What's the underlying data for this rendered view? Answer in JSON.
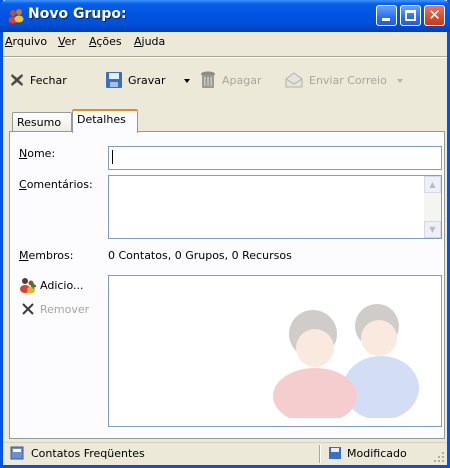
{
  "window": {
    "title": "Novo Grupo:"
  },
  "menu": [
    "Arquivo",
    "Ver",
    "Ações",
    "Ajuda"
  ],
  "toolbar": {
    "close_label": "Fechar",
    "save_label": "Gravar",
    "delete_label": "Apagar",
    "send_label": "Enviar Correio"
  },
  "tabs": [
    "Resumo",
    "Detalhes"
  ],
  "form": {
    "name_label": "Nome:",
    "name_value": "",
    "comments_label": "Comentários:",
    "comments_value": "",
    "members_label": "Membros:",
    "members_summary": "0 Contatos, 0 Grupos, 0 Recursos",
    "add_label": "Adicio...",
    "remove_label": "Remover"
  },
  "status": {
    "left": "Contatos Freqüentes",
    "right": "Modificado"
  },
  "colors": {
    "titlebar": "#0054e3",
    "tab_highlight": "#e68b2c",
    "face": "#ece9d8"
  }
}
